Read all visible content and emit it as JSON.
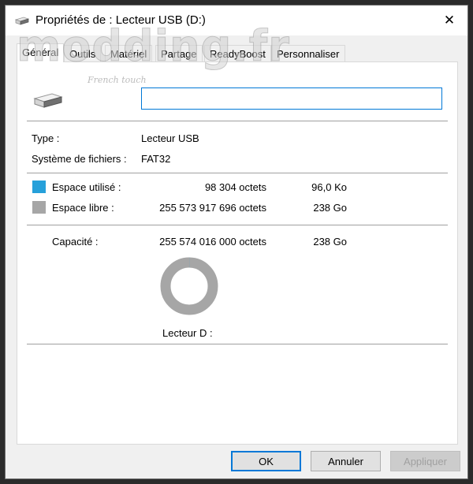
{
  "window": {
    "title": "Propriétés de : Lecteur USB (D:)",
    "close_glyph": "✕"
  },
  "watermark": {
    "text": "modding.fr",
    "sub": "French touch"
  },
  "tabs": [
    {
      "label": "Général",
      "active": true
    },
    {
      "label": "Outils"
    },
    {
      "label": "Matériel"
    },
    {
      "label": "Partage"
    },
    {
      "label": "ReadyBoost"
    },
    {
      "label": "Personnaliser"
    }
  ],
  "general": {
    "name_value": "",
    "type_label": "Type :",
    "type_value": "Lecteur USB",
    "fs_label": "Système de fichiers :",
    "fs_value": "FAT32",
    "used": {
      "label": "Espace utilisé :",
      "bytes": "98 304 octets",
      "size": "96,0 Ko",
      "color": "#26a0da"
    },
    "free": {
      "label": "Espace libre :",
      "bytes": "255 573 917 696 octets",
      "size": "238 Go",
      "color": "#a6a6a6"
    },
    "capacity": {
      "label": "Capacité :",
      "bytes": "255 574 016 000 octets",
      "size": "238 Go"
    },
    "used_fraction": 4e-07,
    "drive_label": "Lecteur D :"
  },
  "buttons": {
    "ok": "OK",
    "cancel": "Annuler",
    "apply": "Appliquer"
  },
  "icons": {
    "drive": "usb-drive-icon",
    "title": "usb-drive-icon",
    "close": "close-icon"
  }
}
